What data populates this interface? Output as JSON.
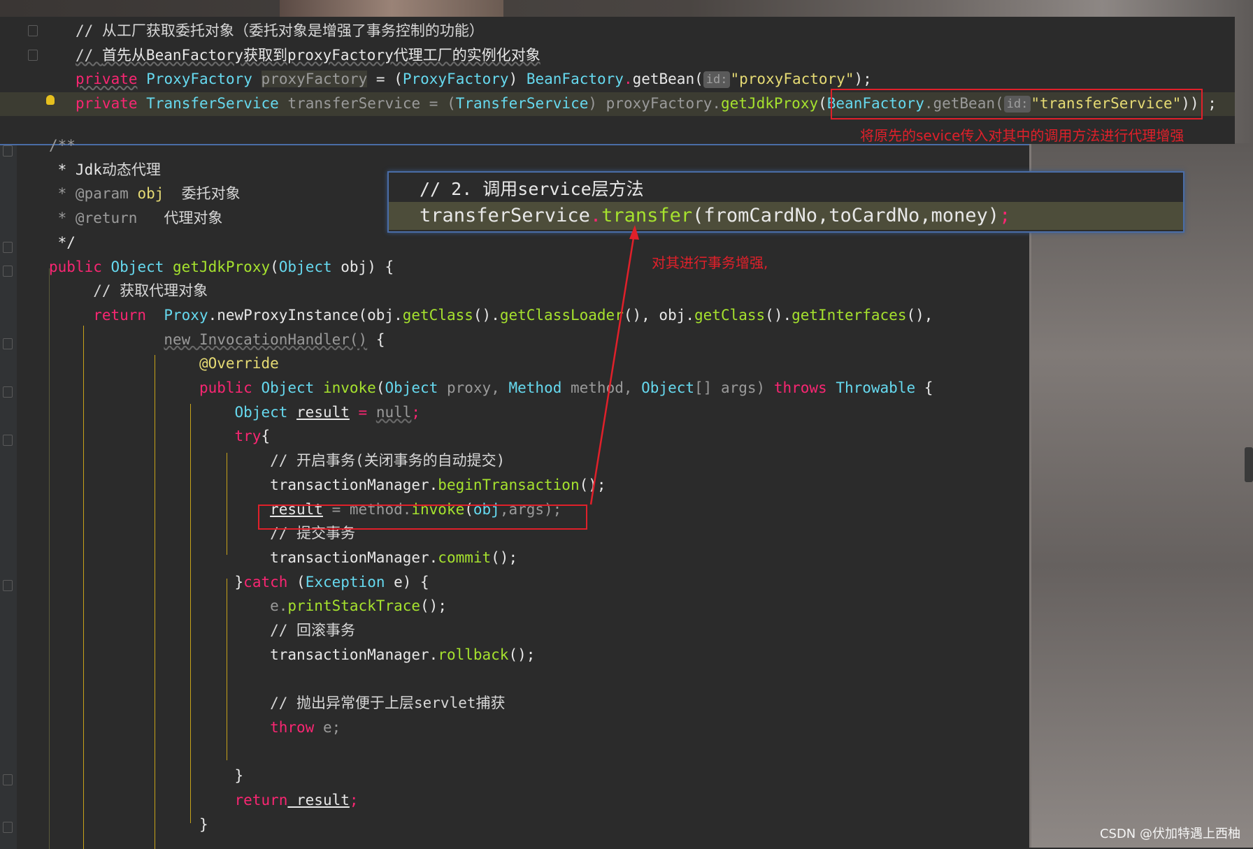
{
  "top_panel": {
    "line1": "// 从工厂获取委托对象（委托对象是增强了事务控制的功能）",
    "line2_prefix": "// ",
    "line2_text": "首先从BeanFactory获取到proxyFactory代理工厂的实例化对象",
    "line3": {
      "kw": "private",
      "type": "ProxyFactory",
      "var": "proxyFactory",
      "eq": " = (",
      "cast": "ProxyFactory",
      "rest1": ") ",
      "cls": "BeanFactory",
      "dot": ".",
      "method": "getBean(",
      "hint": "id:",
      "str": "\"proxyFactory\"",
      "end": ");"
    },
    "line4": {
      "kw": "private",
      "type": "TransferService",
      "var": "transferService",
      "eq": " = (",
      "cast": "TransferService",
      "rest1": ") proxyFactory.",
      "method": "getJdkProxy",
      "paren": "(",
      "cls": "BeanFactory",
      "method2": ".getBean(",
      "hint": "id:",
      "str": "\"transferService\"",
      "end": ")) ;"
    },
    "annotation": "将原先的sevice传入对其中的调用方法进行代理增强"
  },
  "callout": {
    "comment": "// 2. 调用service层方法",
    "code_obj": "transferService",
    "code_dot": ".",
    "code_method": "transfer",
    "code_args": "(fromCardNo,toCardNo,money)",
    "code_end": ";"
  },
  "arrow_annotation": "对其进行事务增强,",
  "main_code": {
    "doc1": "/**",
    "doc2_a": " * Jdk",
    "doc2_b": "动态代理",
    "doc3_a": " * @param ",
    "doc3_b": "obj",
    "doc3_c": "  委托对象",
    "doc4_a": " * @return",
    "doc4_b": "   代理对象",
    "doc5": " */",
    "sig_kw": "public",
    "sig_type": "Object",
    "sig_fn": "getJdkProxy",
    "sig_p1": "(",
    "sig_ptype": "Object",
    "sig_rest": " obj) {",
    "c_getproxy": "// 获取代理对象",
    "ret_kw": "return",
    "ret_cls": "Proxy",
    "ret_m1": ".newProxyInstance(obj.",
    "ret_m2": "getClass",
    "ret_m3": "().",
    "ret_m4": "getClassLoader",
    "ret_m5": "(), obj.",
    "ret_m6": "getClass",
    "ret_m7": "().",
    "ret_m8": "getInterfaces",
    "ret_m9": "(),",
    "new_ih": "new InvocationHandler()",
    "new_brace": " {",
    "override": "@Override",
    "inv_kw": "public",
    "inv_type": "Object",
    "inv_fn": "invoke",
    "inv_p1": "(",
    "inv_t1": "Object",
    "inv_v1": " proxy, ",
    "inv_t2": "Method",
    "inv_v2": " method, ",
    "inv_t3": "Object",
    "inv_v3": "[] args) ",
    "inv_throws": "throws",
    "inv_t4": " Throwable",
    "inv_end": " {",
    "res_type": "Object",
    "res_var": "result",
    "res_eq": " = ",
    "res_null": "null",
    "res_end": ";",
    "try_kw": "try",
    "try_brace": "{",
    "c_begin": "// 开启事务(关闭事务的自动提交)",
    "tm1_obj": "transactionManager.",
    "tm1_fn": "beginTransaction",
    "tm1_end": "();",
    "inv_res": "result",
    "inv_eq": " = method.",
    "inv_call": "invoke",
    "inv_args_a": "(",
    "inv_args_obj": "obj",
    "inv_args_b": ",args);",
    "c_commit": "// 提交事务",
    "tm2_obj": "transactionManager.",
    "tm2_fn": "commit",
    "tm2_end": "();",
    "catch_open": "}",
    "catch_kw": "catch",
    "catch_p": " (",
    "catch_type": "Exception",
    "catch_rest": " e) {",
    "pst_obj": "e.",
    "pst_fn": "printStackTrace",
    "pst_end": "();",
    "c_rollback": "// 回滚事务",
    "tm3_obj": "transactionManager.",
    "tm3_fn": "rollback",
    "tm3_end": "();",
    "c_throw": "// 抛出异常便于上层servlet捕获",
    "throw_kw": "throw",
    "throw_rest": " e;",
    "close1": "}",
    "ret2_kw": "return",
    "ret2_var": " result",
    "ret2_end": ";",
    "close2": "}"
  },
  "watermark": "CSDN @伏加特遇上西柚",
  "colors": {
    "keyword": "#f92672",
    "type": "#66d9ef",
    "function": "#a6e22e",
    "string": "#e6db74",
    "annotation_red": "#e0202a",
    "callout_border": "#4a6da7"
  }
}
